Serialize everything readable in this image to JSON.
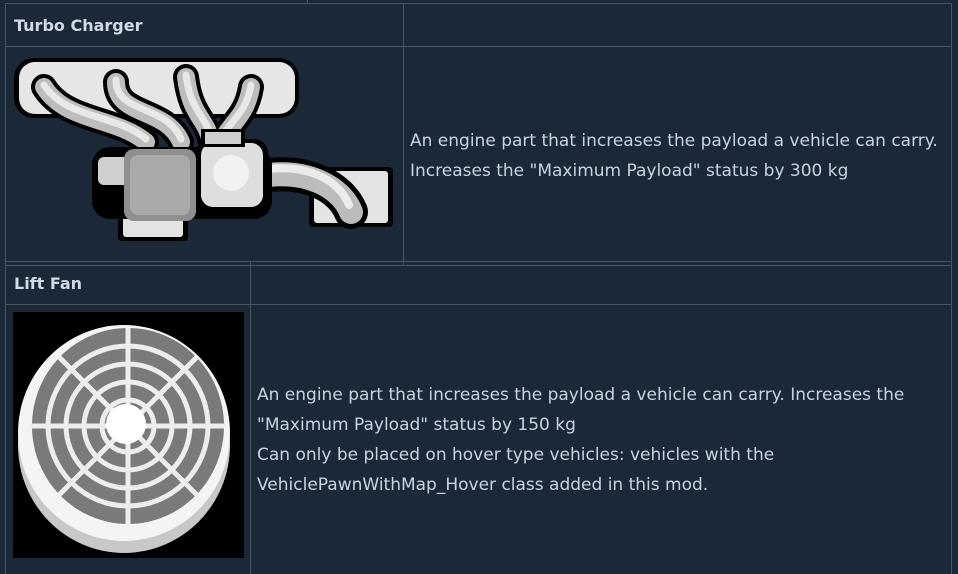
{
  "items": [
    {
      "title": "Turbo Charger",
      "icon": "turbo-charger-icon",
      "description_lines": [
        "An engine part that increases the payload a vehicle can carry.",
        "Increases the \"Maximum Payload\" status by 300 kg"
      ]
    },
    {
      "title": "Lift Fan",
      "icon": "lift-fan-icon",
      "description_lines": [
        "An engine part that increases the payload a vehicle can carry. Increases the",
        "\"Maximum Payload\" status by 150 kg",
        "Can only be placed on hover type vehicles: vehicles with the",
        "VehiclePawnWithMap_Hover class added in this mod."
      ]
    }
  ],
  "colors": {
    "background": "#1b2838",
    "border": "#4a5562",
    "text": "#c6d4df"
  }
}
